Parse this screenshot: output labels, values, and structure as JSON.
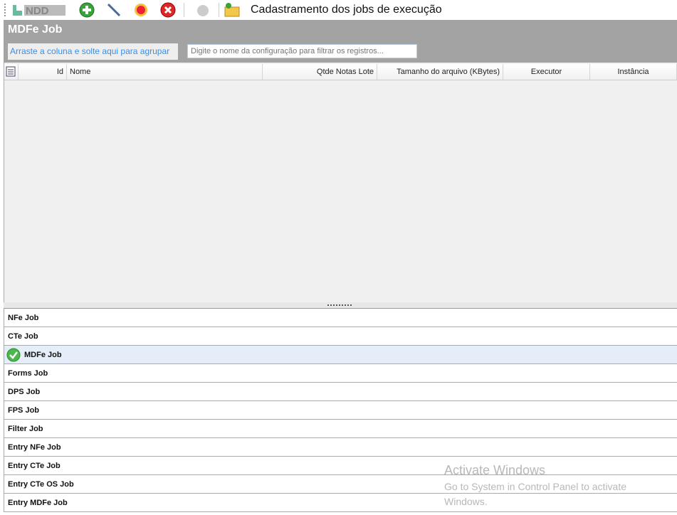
{
  "toolbar": {
    "logo": "NDD",
    "title": "Cadastramento dos jobs de execução",
    "icons": [
      "add-icon",
      "edit-icon",
      "settings-icon",
      "delete-icon",
      "disabled-icon",
      "open-folder-icon"
    ]
  },
  "panel": {
    "title": "MDFe Job",
    "group_hint": "Arraste a coluna e solte aqui para agrupar",
    "filter_placeholder": "Digite o nome da configuração para filtrar os registros..."
  },
  "grid": {
    "columns": [
      "Id",
      "Nome",
      "Qtde Notas Lote",
      "Tamanho do arquivo (KBytes)",
      "Executor",
      "Instância"
    ]
  },
  "nav": {
    "items": [
      "NFe Job",
      "CTe Job",
      "MDFe Job",
      "Forms Job",
      "DPS Job",
      "FPS Job",
      "Filter Job",
      "Entry NFe Job",
      "Entry CTe Job",
      "Entry CTe OS Job",
      "Entry MDFe Job"
    ],
    "selected": "MDFe Job"
  },
  "watermark": {
    "line1": "Activate Windows",
    "line2": "Go to System in Control Panel to activate Windows."
  }
}
